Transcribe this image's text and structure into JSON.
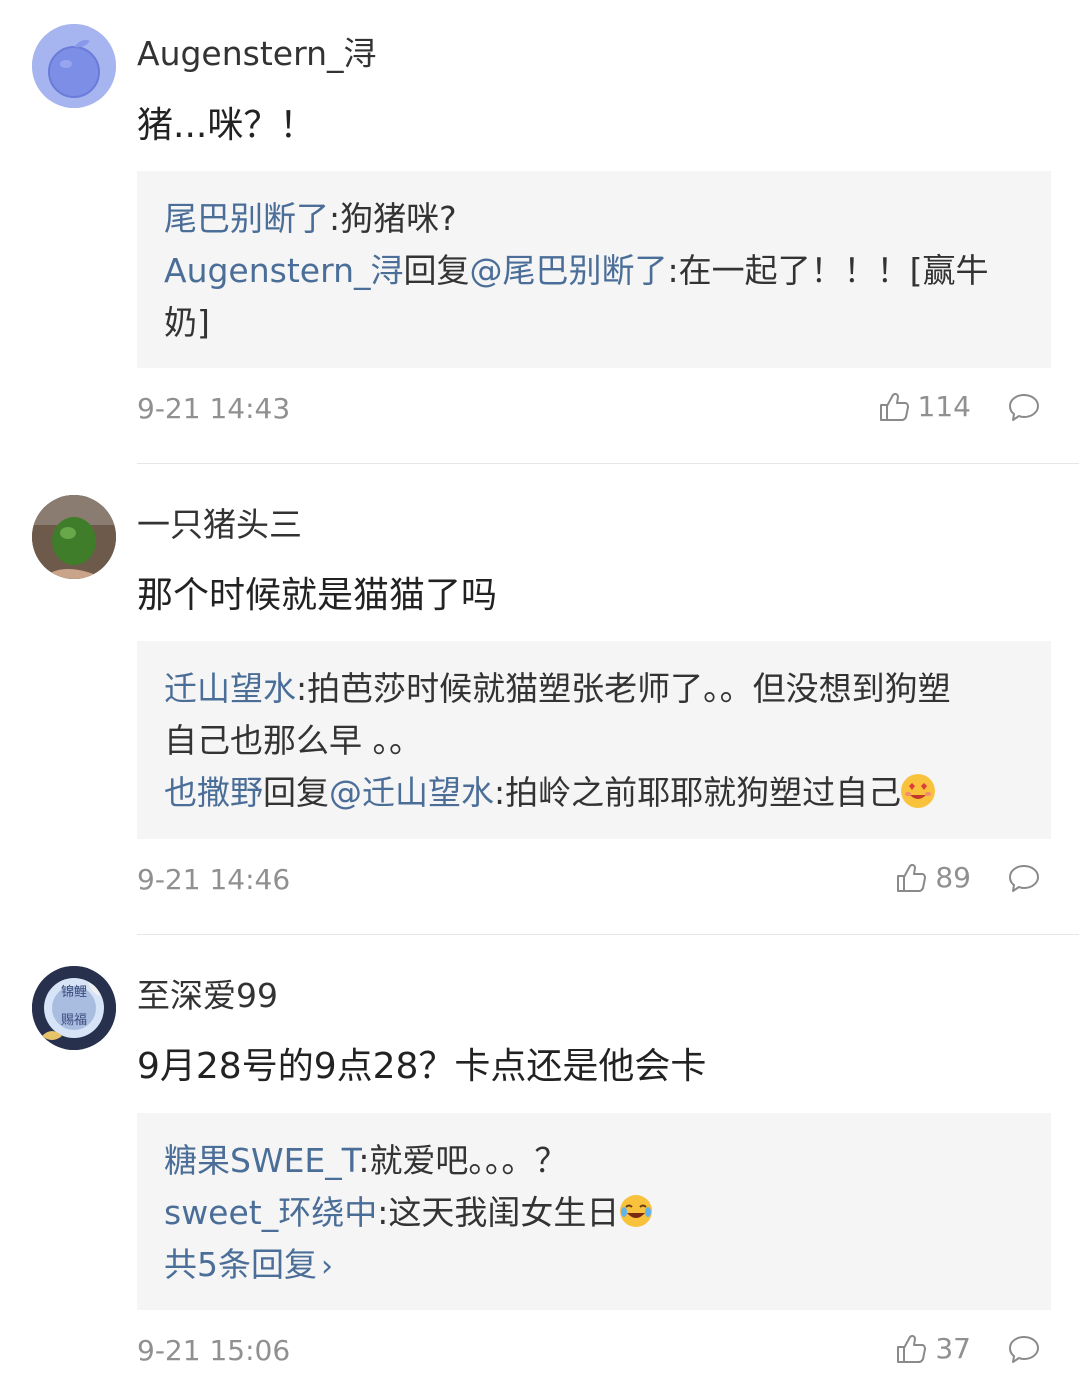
{
  "comments": [
    {
      "username": "Augenstern_浔",
      "text": "猪...咪？！",
      "replies": [
        {
          "user": "尾巴别断了",
          "reply_to": null,
          "text": ":狗猪咪?"
        },
        {
          "user": "Augenstern_浔",
          "reply_word": "回复",
          "reply_to": "@尾巴别断了",
          "text": ":在一起了！！！[赢牛",
          "text_cont": "奶]"
        }
      ],
      "more_replies": null,
      "time": "9-21 14:43",
      "likes": "114"
    },
    {
      "username": "一只猪头三",
      "text": "那个时候就是猫猫了吗",
      "replies": [
        {
          "user": "迁山望水",
          "text": ":拍芭莎时候就猫塑张老师了。。但没想到狗塑",
          "text_cont": "自己也那么早 。。"
        },
        {
          "user": "也撒野",
          "reply_word": "回复",
          "reply_to": "@迁山望水",
          "text": ":拍岭之前耶耶就狗塑过自己",
          "emoji": "heart-eyes-emoji"
        }
      ],
      "time": "9-21 14:46",
      "likes": "89"
    },
    {
      "username": "至深爱99",
      "avatar_text": "锦鲤赐福",
      "text": "9月28号的9点28？卡点还是他会卡",
      "replies": [
        {
          "user": "糖果SWEE_T",
          "text": ":就爱吧。。。？"
        },
        {
          "user": "sweet_环绕中",
          "text": ":这天我闺女生日",
          "emoji": "laugh-cry-emoji"
        }
      ],
      "more_replies": "共5条回复",
      "time": "9-21 15:06",
      "likes": "37"
    }
  ],
  "colors": {
    "link": "#4b6e98",
    "reply_bg": "#f5f5f5",
    "meta": "#909090"
  }
}
